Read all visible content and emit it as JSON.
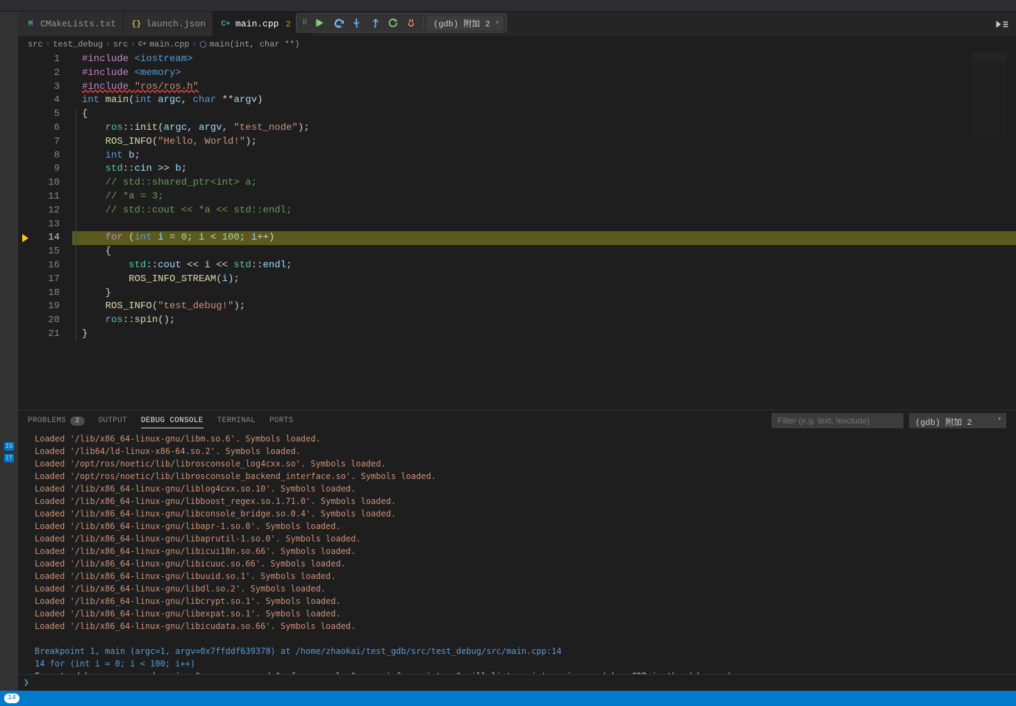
{
  "tabs": [
    {
      "label": "CMakeLists.txt",
      "icon": "M",
      "icon_color": "#519aba",
      "active": false
    },
    {
      "label": "launch.json",
      "icon": "{}",
      "icon_color": "#cbcb41",
      "active": false
    },
    {
      "label": "main.cpp",
      "icon": "C+",
      "icon_color": "#519aba",
      "active": true,
      "modified_count": "2"
    }
  ],
  "debug_toolbar": {
    "config": "(gdb) 附加 2"
  },
  "breadcrumbs": [
    {
      "label": "src"
    },
    {
      "label": "test_debug"
    },
    {
      "label": "src"
    },
    {
      "label": "main.cpp",
      "icon": "C+"
    },
    {
      "label": "main(int, char **)",
      "icon": "cube"
    }
  ],
  "code": {
    "lines": [
      {
        "n": 1,
        "tokens": [
          [
            "tok-pre",
            "#include "
          ],
          [
            "tok-inc",
            "<iostream>"
          ]
        ]
      },
      {
        "n": 2,
        "tokens": [
          [
            "tok-pre",
            "#include "
          ],
          [
            "tok-inc",
            "<memory>"
          ]
        ]
      },
      {
        "n": 3,
        "tokens": [
          [
            "tok-pre err-underline",
            "#include "
          ],
          [
            "tok-str err-underline",
            "\"ros/ros.h\""
          ]
        ]
      },
      {
        "n": 4,
        "tokens": [
          [
            "tok-type",
            "int "
          ],
          [
            "tok-fn",
            "main"
          ],
          [
            "tok-punct",
            "("
          ],
          [
            "tok-type",
            "int "
          ],
          [
            "tok-var",
            "argc"
          ],
          [
            "tok-punct",
            ", "
          ],
          [
            "tok-type",
            "char "
          ],
          [
            "tok-op",
            "**"
          ],
          [
            "tok-var",
            "argv"
          ],
          [
            "tok-punct",
            ")"
          ]
        ]
      },
      {
        "n": 5,
        "tokens": [
          [
            "tok-punct",
            "{"
          ]
        ]
      },
      {
        "n": 6,
        "indent": 1,
        "tokens": [
          [
            "tok-ns",
            "ros"
          ],
          [
            "tok-op",
            "::"
          ],
          [
            "tok-fn",
            "init"
          ],
          [
            "tok-punct",
            "("
          ],
          [
            "tok-var",
            "argc"
          ],
          [
            "tok-punct",
            ", "
          ],
          [
            "tok-var",
            "argv"
          ],
          [
            "tok-punct",
            ", "
          ],
          [
            "tok-str",
            "\"test_node\""
          ],
          [
            "tok-punct",
            ");"
          ]
        ]
      },
      {
        "n": 7,
        "indent": 1,
        "tokens": [
          [
            "tok-fn",
            "ROS_INFO"
          ],
          [
            "tok-punct",
            "("
          ],
          [
            "tok-str",
            "\"Hello, World!\""
          ],
          [
            "tok-punct",
            ");"
          ]
        ]
      },
      {
        "n": 8,
        "indent": 1,
        "tokens": [
          [
            "tok-type",
            "int "
          ],
          [
            "tok-var",
            "b"
          ],
          [
            "tok-punct",
            ";"
          ]
        ]
      },
      {
        "n": 9,
        "indent": 1,
        "tokens": [
          [
            "tok-ns",
            "std"
          ],
          [
            "tok-op",
            "::"
          ],
          [
            "tok-var",
            "cin"
          ],
          [
            "tok-op",
            " >> "
          ],
          [
            "tok-var",
            "b"
          ],
          [
            "tok-punct",
            ";"
          ]
        ]
      },
      {
        "n": 10,
        "indent": 1,
        "tokens": [
          [
            "tok-cmt",
            "// std::shared_ptr<int> a;"
          ]
        ]
      },
      {
        "n": 11,
        "indent": 1,
        "tokens": [
          [
            "tok-cmt",
            "// *a = 3;"
          ]
        ]
      },
      {
        "n": 12,
        "indent": 1,
        "tokens": [
          [
            "tok-cmt",
            "// std::cout << *a << std::endl;"
          ]
        ]
      },
      {
        "n": 13,
        "tokens": []
      },
      {
        "n": 14,
        "indent": 1,
        "hl": true,
        "bp": true,
        "tokens": [
          [
            "tok-kw",
            "for "
          ],
          [
            "tok-punct",
            "("
          ],
          [
            "tok-type",
            "int "
          ],
          [
            "tok-var",
            "i"
          ],
          [
            "tok-op",
            " = "
          ],
          [
            "tok-num",
            "0"
          ],
          [
            "tok-punct",
            "; "
          ],
          [
            "tok-var",
            "i"
          ],
          [
            "tok-op",
            " < "
          ],
          [
            "tok-num",
            "100"
          ],
          [
            "tok-punct",
            "; "
          ],
          [
            "tok-var",
            "i"
          ],
          [
            "tok-op",
            "++"
          ],
          [
            "tok-punct",
            ")"
          ]
        ]
      },
      {
        "n": 15,
        "indent": 1,
        "tokens": [
          [
            "tok-punct",
            "{"
          ]
        ]
      },
      {
        "n": 16,
        "indent": 2,
        "tokens": [
          [
            "tok-ns",
            "std"
          ],
          [
            "tok-op",
            "::"
          ],
          [
            "tok-var",
            "cout"
          ],
          [
            "tok-op",
            " << "
          ],
          [
            "tok-var",
            "i"
          ],
          [
            "tok-op",
            " << "
          ],
          [
            "tok-ns",
            "std"
          ],
          [
            "tok-op",
            "::"
          ],
          [
            "tok-var",
            "endl"
          ],
          [
            "tok-punct",
            ";"
          ]
        ]
      },
      {
        "n": 17,
        "indent": 2,
        "tokens": [
          [
            "tok-fn",
            "ROS_INFO_STREAM"
          ],
          [
            "tok-punct",
            "("
          ],
          [
            "tok-var",
            "i"
          ],
          [
            "tok-punct",
            ");"
          ]
        ]
      },
      {
        "n": 18,
        "indent": 1,
        "tokens": [
          [
            "tok-punct",
            "}"
          ]
        ]
      },
      {
        "n": 19,
        "indent": 1,
        "tokens": [
          [
            "tok-fn",
            "ROS_INFO"
          ],
          [
            "tok-punct",
            "("
          ],
          [
            "tok-str",
            "\"test_debug!\""
          ],
          [
            "tok-punct",
            ");"
          ]
        ]
      },
      {
        "n": 20,
        "indent": 1,
        "tokens": [
          [
            "tok-ns",
            "ros"
          ],
          [
            "tok-op",
            "::"
          ],
          [
            "tok-fn",
            "spin"
          ],
          [
            "tok-punct",
            "();"
          ]
        ]
      },
      {
        "n": 21,
        "tokens": [
          [
            "tok-punct",
            "}"
          ]
        ]
      }
    ]
  },
  "panel": {
    "tabs": [
      {
        "label": "PROBLEMS",
        "badge": "2"
      },
      {
        "label": "OUTPUT"
      },
      {
        "label": "DEBUG CONSOLE",
        "active": true
      },
      {
        "label": "TERMINAL"
      },
      {
        "label": "PORTS"
      }
    ],
    "filter_placeholder": "Filter (e.g. text, !exclude)",
    "select_value": "(gdb) 附加 2",
    "log": [
      "Loaded '/lib/x86_64-linux-gnu/libm.so.6'. Symbols loaded.",
      "Loaded '/lib64/ld-linux-x86-64.so.2'. Symbols loaded.",
      "Loaded '/opt/ros/noetic/lib/librosconsole_log4cxx.so'. Symbols loaded.",
      "Loaded '/opt/ros/noetic/lib/librosconsole_backend_interface.so'. Symbols loaded.",
      "Loaded '/lib/x86_64-linux-gnu/liblog4cxx.so.10'. Symbols loaded.",
      "Loaded '/lib/x86_64-linux-gnu/libboost_regex.so.1.71.0'. Symbols loaded.",
      "Loaded '/lib/x86_64-linux-gnu/libconsole_bridge.so.0.4'. Symbols loaded.",
      "Loaded '/lib/x86_64-linux-gnu/libapr-1.so.0'. Symbols loaded.",
      "Loaded '/lib/x86_64-linux-gnu/libaprutil-1.so.0'. Symbols loaded.",
      "Loaded '/lib/x86_64-linux-gnu/libicui18n.so.66'. Symbols loaded.",
      "Loaded '/lib/x86_64-linux-gnu/libicuuc.so.66'. Symbols loaded.",
      "Loaded '/lib/x86_64-linux-gnu/libuuid.so.1'. Symbols loaded.",
      "Loaded '/lib/x86_64-linux-gnu/libdl.so.2'. Symbols loaded.",
      "Loaded '/lib/x86_64-linux-gnu/libcrypt.so.1'. Symbols loaded.",
      "Loaded '/lib/x86_64-linux-gnu/libexpat.so.1'. Symbols loaded.",
      "Loaded '/lib/x86_64-linux-gnu/libicudata.so.66'. Symbols loaded."
    ],
    "breakpoint_line": "Breakpoint 1, main (argc=1, argv=0x7ffddf639378) at /home/zhaokai/test_gdb/src/test_debug/src/main.cpp:14",
    "current_frame": "14         for (int i = 0; i < 100; i++)",
    "hint": "Execute debugger commands using \"-exec <command>\", for example \"-exec info registers\" will list registers in use (when GDB is the debugger)"
  },
  "statusbar": {
    "left_count": "14"
  }
}
